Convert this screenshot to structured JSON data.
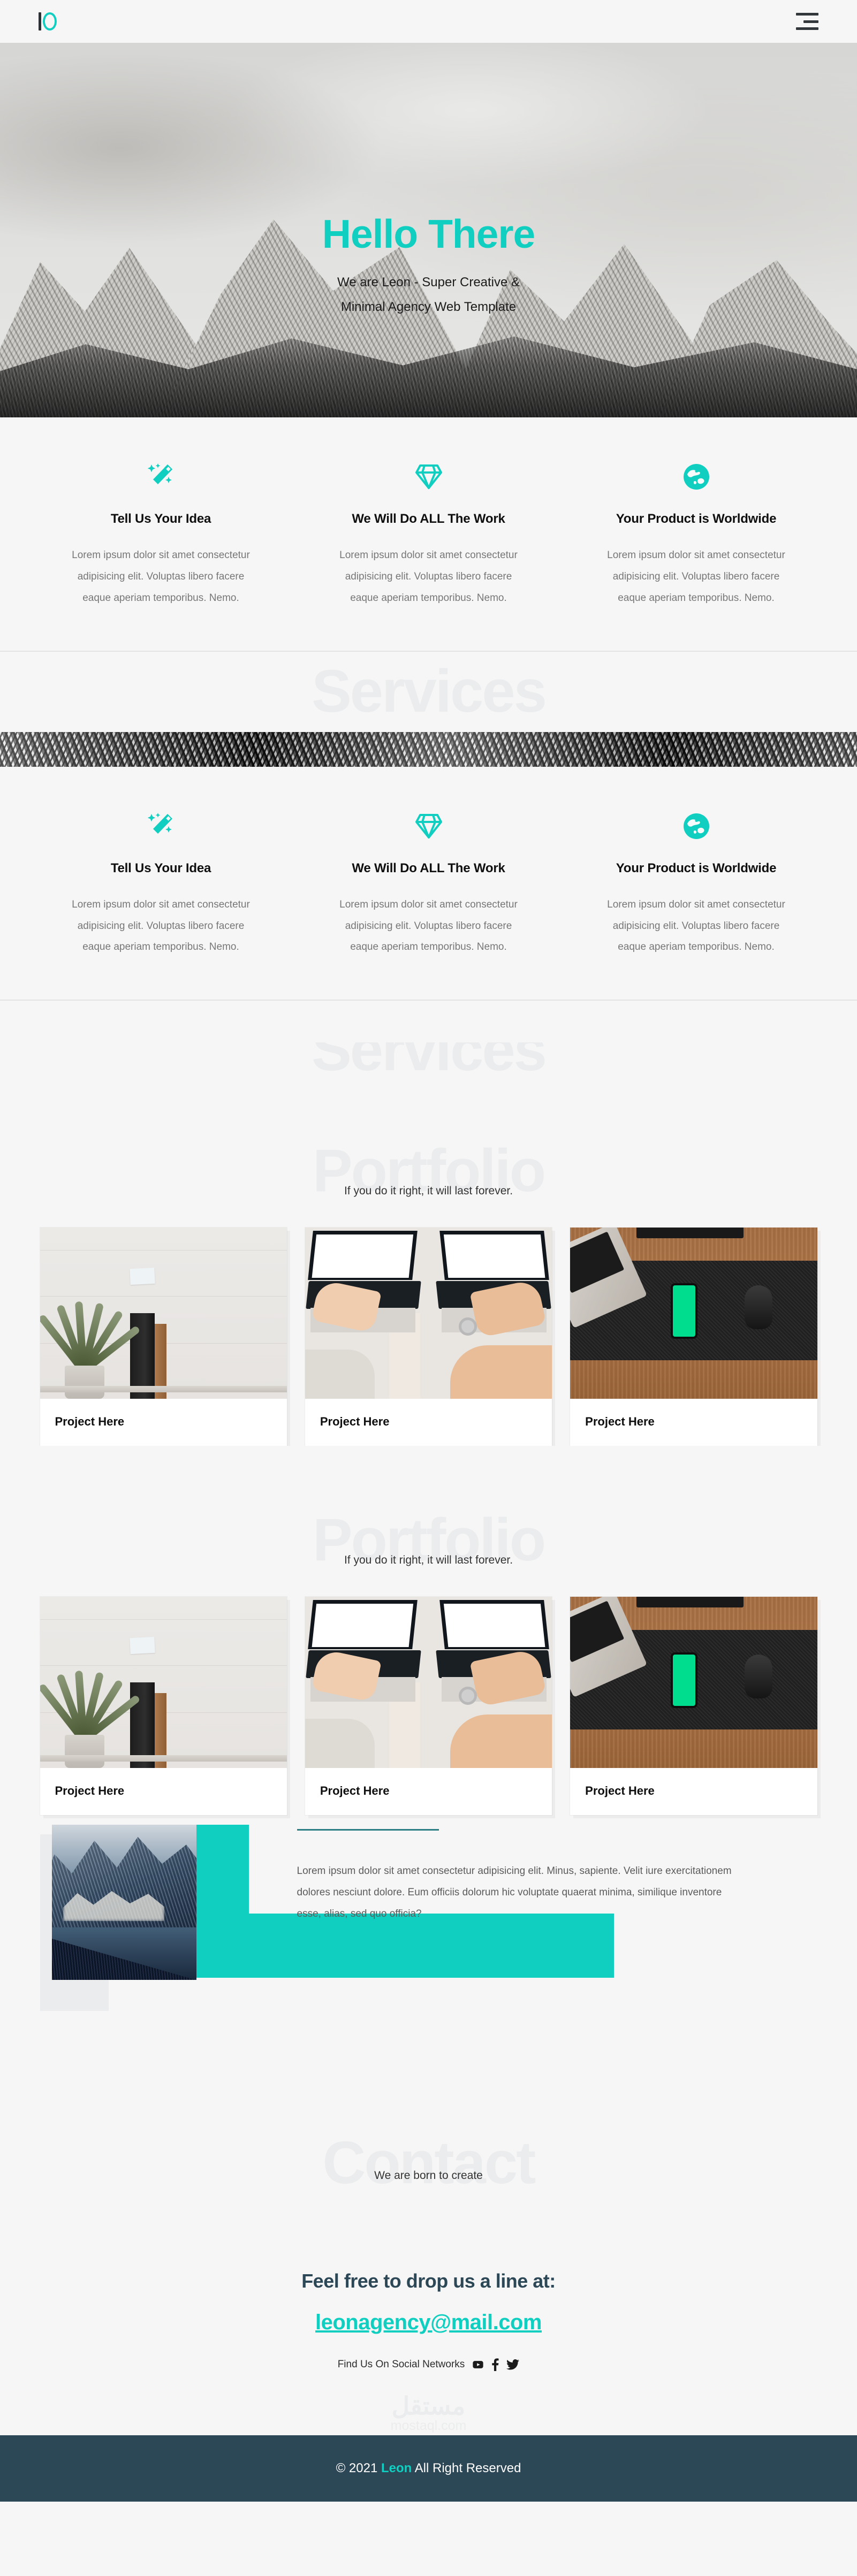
{
  "theme": {
    "accent": "#10cfc0",
    "dark": "#2c4755",
    "bg": "#f6f6f6",
    "ghost": "#ebeced"
  },
  "header": {
    "logo_name": "leon-logo",
    "menu_label": "menu-toggle"
  },
  "hero": {
    "title": "Hello There",
    "subtitle_line1": "We are Leon - Super Creative &",
    "subtitle_line2": "Minimal Agency Web Template"
  },
  "features": [
    {
      "icon": "magic-wand-icon",
      "title": "Tell Us Your Idea",
      "text": "Lorem ipsum dolor sit amet consectetur adipisicing elit. Voluptas libero facere eaque aperiam temporibus. Nemo."
    },
    {
      "icon": "diamond-icon",
      "title": "We Will Do ALL The Work",
      "text": "Lorem ipsum dolor sit amet consectetur adipisicing elit. Voluptas libero facere eaque aperiam temporibus. Nemo."
    },
    {
      "icon": "globe-icon",
      "title": "Your Product is Worldwide",
      "text": "Lorem ipsum dolor sit amet consectetur adipisicing elit. Voluptas libero facere eaque aperiam temporibus. Nemo."
    }
  ],
  "features2": [
    {
      "icon": "magic-wand-icon",
      "title": "Tell Us Your Idea",
      "text": "Lorem ipsum dolor sit amet consectetur adipisicing elit. Voluptas libero facere eaque aperiam temporibus. Nemo."
    },
    {
      "icon": "diamond-icon",
      "title": "We Will Do ALL The Work",
      "text": "Lorem ipsum dolor sit amet consectetur adipisicing elit. Voluptas libero facere eaque aperiam temporibus. Nemo."
    },
    {
      "icon": "globe-icon",
      "title": "Your Product is Worldwide",
      "text": "Lorem ipsum dolor sit amet consectetur adipisicing elit. Voluptas libero facere eaque aperiam temporibus. Nemo."
    }
  ],
  "services": {
    "ghost_word": "Services"
  },
  "services2": {
    "ghost_word": "Services"
  },
  "portfolio": {
    "ghost_word": "Portfolio",
    "subtitle": "If you do it right, it will last forever.",
    "cards": [
      {
        "caption": "Project Here",
        "image": "plant-and-frames-photo"
      },
      {
        "caption": "Project Here",
        "image": "hands-typing-laptops-photo"
      },
      {
        "caption": "Project Here",
        "image": "desk-phone-mouse-photo"
      }
    ]
  },
  "portfolio2": {
    "ghost_word": "Portfolio",
    "subtitle": "If you do it right, it will last forever.",
    "cards": [
      {
        "caption": "Project Here",
        "image": "plant-and-frames-photo"
      },
      {
        "caption": "Project Here",
        "image": "hands-typing-laptops-photo"
      },
      {
        "caption": "Project Here",
        "image": "desk-phone-mouse-photo"
      }
    ]
  },
  "about": {
    "image": "mountain-valley-photo",
    "text": "Lorem ipsum dolor sit amet consectetur adipisicing elit. Minus, sapiente. Velit iure exercitationem dolores nesciunt dolore. Eum officiis dolorum hic voluptate quaerat minima, similique inventore esse, alias, sed quo officia?"
  },
  "contact": {
    "ghost_word": "Contact",
    "subtitle": "We are born to create",
    "invite": "Feel free to drop us a line at:",
    "email": "leonagency@mail.com",
    "social_label": "Find Us On Social Networks",
    "socials": [
      "youtube-icon",
      "facebook-icon",
      "twitter-icon"
    ],
    "watermark_arabic": "مستقل",
    "watermark_latin": "mostaql.com"
  },
  "footer": {
    "prefix": "© 2021 ",
    "brand": "Leon",
    "suffix": " All Right Reserved"
  }
}
